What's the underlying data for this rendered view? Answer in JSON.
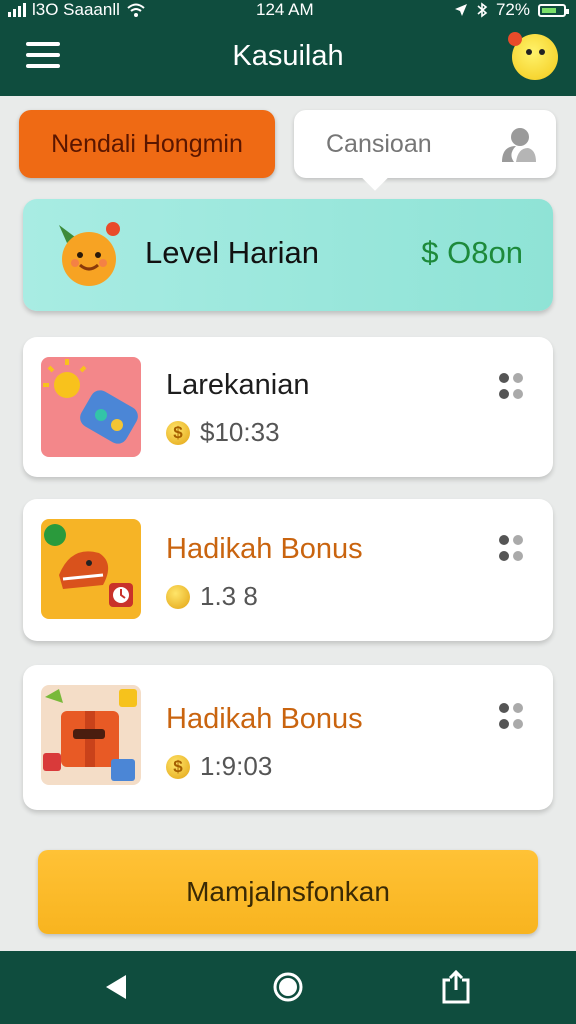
{
  "status_bar": {
    "carrier": "l3O Saaanll",
    "time": "124 AM",
    "battery": "72%"
  },
  "header": {
    "title": "Kasuilah"
  },
  "controls": {
    "primary_button": "Nendali Hongmin",
    "search_placeholder": "Cansioan"
  },
  "banner": {
    "label": "Level Harian",
    "amount": "$ O8on"
  },
  "cards": [
    {
      "title": "Larekanian",
      "value": "$10:33",
      "coin_symbol": "$",
      "title_color": "#1d1d1d"
    },
    {
      "title": "Hadikah Bonus",
      "value": "1.3 8",
      "coin_symbol": "",
      "title_color": "#c9640f"
    },
    {
      "title": "Hadikah Bonus",
      "value": "1:9:03",
      "coin_symbol": "$",
      "title_color": "#c9640f"
    }
  ],
  "cta": {
    "label": "Mamjalnsfonkan"
  },
  "nav": {
    "icons": [
      "back-icon",
      "home-icon",
      "share-icon"
    ]
  },
  "colors": {
    "primary": "#0f4d3e",
    "accent_orange": "#ef6a14",
    "cta_yellow": "#f8b41f",
    "banner_teal": "#a8ece3",
    "money_green": "#1d8a3b"
  }
}
